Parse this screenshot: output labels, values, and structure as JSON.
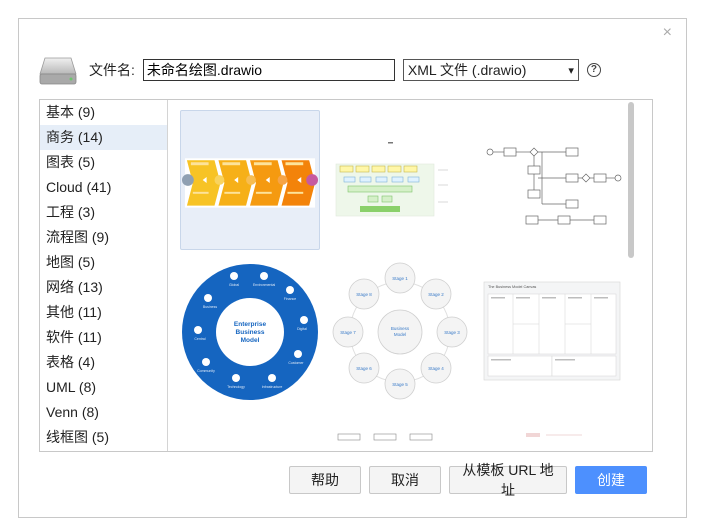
{
  "dialog": {
    "close_label": "×",
    "filename_label": "文件名:",
    "filename_value": "未命名绘图.drawio",
    "format_selected": "XML 文件 (.drawio)",
    "format_arrow": "▾",
    "help_mark": "?"
  },
  "categories": [
    {
      "label": "基本 (9)"
    },
    {
      "label": "商务 (14)"
    },
    {
      "label": "图表 (5)"
    },
    {
      "label": "Cloud (41)"
    },
    {
      "label": "工程 (3)"
    },
    {
      "label": "流程图 (9)"
    },
    {
      "label": "地图 (5)"
    },
    {
      "label": "网络 (13)"
    },
    {
      "label": "其他 (11)"
    },
    {
      "label": "软件 (11)"
    },
    {
      "label": "表格 (4)"
    },
    {
      "label": "UML (8)"
    },
    {
      "label": "Venn (8)"
    },
    {
      "label": "线框图 (5)"
    }
  ],
  "selected_category_index": 1,
  "templates": {
    "bmc": {
      "center_title": "Enterprise Business Model",
      "items": [
        "Global Partnerships",
        "Environmental Awareness",
        "Finance",
        "Digital Development",
        "Customer Service",
        "Infrastructure",
        "Technology Certificates",
        "Community",
        "Central Management Service",
        "Business Group"
      ]
    },
    "stages": {
      "center": "Business Model",
      "items": [
        "Stage 1",
        "Stage 2",
        "Stage 3",
        "Stage 4",
        "Stage 5",
        "Stage 6",
        "Stage 7",
        "Stage 8"
      ]
    },
    "canvas_title": "The Business Model Canvas"
  },
  "buttons": {
    "help": "帮助",
    "cancel": "取消",
    "from_url": "从模板 URL 地址",
    "create": "创建"
  },
  "colors": {
    "primary": "#4d90fe",
    "selection": "#e6eef8",
    "bmc_blue": "#1565c0"
  }
}
